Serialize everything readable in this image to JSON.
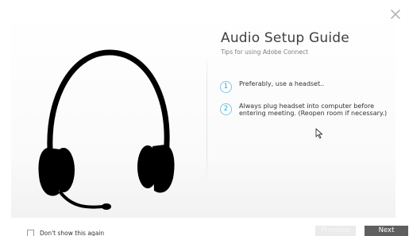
{
  "dialog": {
    "title": "Audio Setup Guide",
    "subtitle": "Tips for using Adobe Connect",
    "close_icon": "close-icon",
    "hero_icon": "headset-icon"
  },
  "tips": [
    {
      "number": "1",
      "text": "Preferably, use a headset.."
    },
    {
      "number": "2",
      "text": "Always plug headset into computer before\nentering meeting. (Reopen room if necessary.)"
    }
  ],
  "footer": {
    "dont_show_label": "Don't show this again",
    "dont_show_checked": false,
    "previous_label": "Previous",
    "previous_enabled": false,
    "next_label": "Next"
  },
  "colors": {
    "accent": "#2ea6dd",
    "accent_border": "#7cc6e8",
    "next_button": "#5f5f5f",
    "previous_button_disabled": "#ebebeb",
    "title_text": "#404040"
  },
  "icons": {
    "cursor": "mouse-pointer-icon",
    "checkbox": "checkbox-icon"
  }
}
